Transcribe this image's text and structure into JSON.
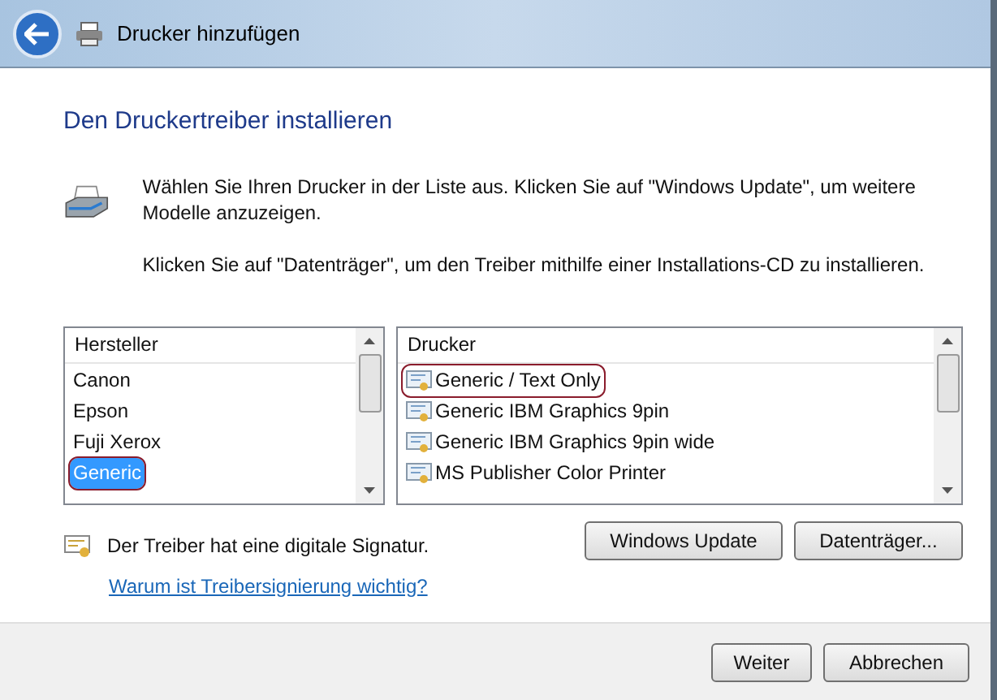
{
  "window": {
    "title": "Drucker hinzufügen"
  },
  "heading": "Den Druckertreiber installieren",
  "instructions": [
    "Wählen Sie Ihren Drucker in der Liste aus. Klicken Sie auf \"Windows Update\", um weitere Modelle anzuzeigen.",
    "Klicken Sie auf \"Datenträger\", um den Treiber mithilfe einer Installations-CD zu installieren."
  ],
  "manufacturers": {
    "header": "Hersteller",
    "items": [
      {
        "label": "Canon",
        "selected": false,
        "circled": false
      },
      {
        "label": "Epson",
        "selected": false,
        "circled": false
      },
      {
        "label": "Fuji Xerox",
        "selected": false,
        "circled": false
      },
      {
        "label": "Generic",
        "selected": true,
        "circled": true
      }
    ]
  },
  "printers": {
    "header": "Drucker",
    "items": [
      {
        "label": "Generic / Text Only",
        "selected": false,
        "circled": true
      },
      {
        "label": "Generic IBM Graphics 9pin",
        "selected": false,
        "circled": false
      },
      {
        "label": "Generic IBM Graphics 9pin wide",
        "selected": false,
        "circled": false
      },
      {
        "label": "MS Publisher Color Printer",
        "selected": false,
        "circled": false
      }
    ]
  },
  "signature": {
    "text": "Der Treiber hat eine digitale Signatur.",
    "link": "Warum ist Treibersignierung wichtig?"
  },
  "buttons": [
    "Windows Update",
    "Datenträger..."
  ],
  "footer_buttons": [
    "Weiter",
    "Abbrechen"
  ]
}
